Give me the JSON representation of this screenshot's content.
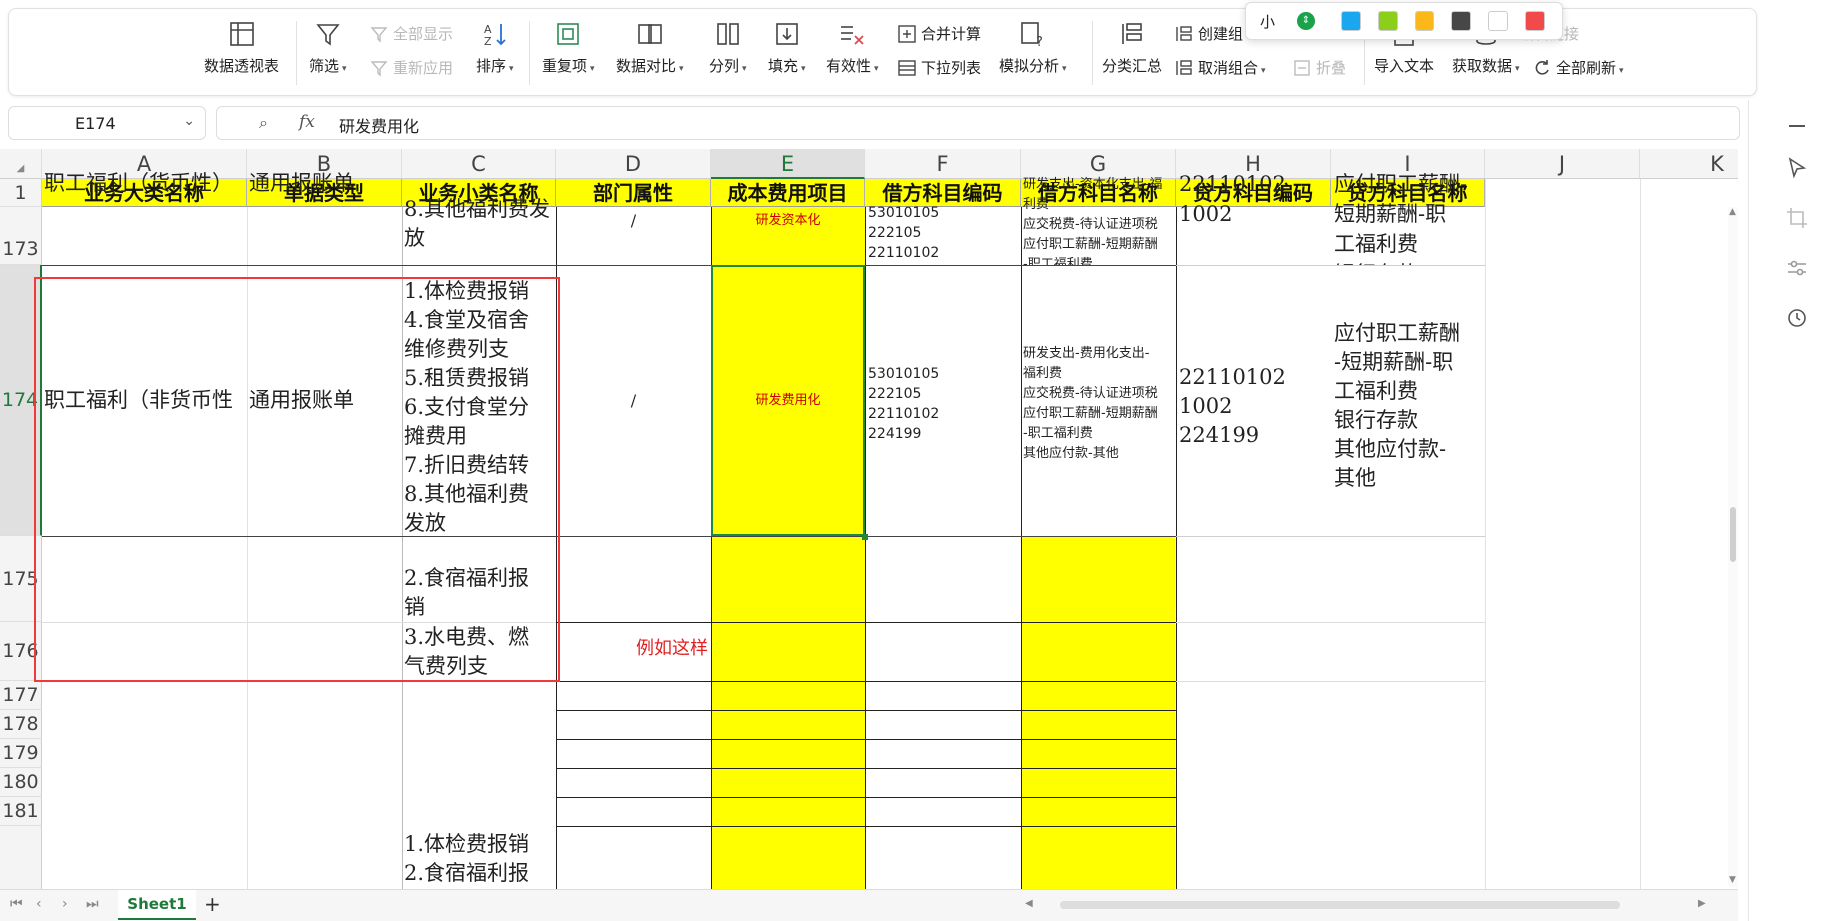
{
  "ribbon": {
    "pivot": "数据透视表",
    "filter": "筛选",
    "show_all": "全部显示",
    "reapply": "重新应用",
    "sort": "排序",
    "duplicates": "重复项",
    "compare": "数据对比",
    "split": "分列",
    "fill": "填充",
    "validity": "有效性",
    "consolidate": "合并计算",
    "dropdown_list": "下拉列表",
    "what_if": "模拟分析",
    "subtotal": "分类汇总",
    "group": "创建组",
    "ungroup": "取消组合",
    "collapse": "折叠",
    "import_text": "导入文本",
    "get_data": "获取数据",
    "refresh_all": "全部刷新",
    "edit_links": "编辑链接"
  },
  "color_popup": {
    "size": "小",
    "colors": [
      "#1aa7f0",
      "#8ccf1a",
      "#fbb818",
      "#474747",
      "#ffffff",
      "#f04a4a"
    ]
  },
  "formula_bar": {
    "name_box": "E174",
    "fx": "fx",
    "content": "研发费用化"
  },
  "columns": [
    "A",
    "B",
    "C",
    "D",
    "E",
    "F",
    "G",
    "H",
    "I",
    "J",
    "K"
  ],
  "rows": {
    "r1": "1",
    "r173": "173",
    "r174": "174",
    "r175": "175",
    "r176": "176",
    "r177": "177",
    "r178": "178",
    "r179": "179",
    "r180": "180",
    "r181": "181"
  },
  "headers": [
    "业务大类名称",
    "单据类型",
    "业务小类名称",
    "部门属性",
    "成本费用项目",
    "借方科目编码",
    "借方科目名称",
    "贷方科目编码",
    "贷方科目名称"
  ],
  "cells": {
    "a173": "职工福利（货币性）",
    "b173": "通用报账单",
    "c173": "8.其他福利费发\n放",
    "d173": "/",
    "e173": "研发资本化",
    "f173": "53010105\n222105\n22110102",
    "g173": "研发支出-资本化支出-福利费\n应交税费-待认证进项税\n应付职工薪酬-短期薪酬\n-职工福利费",
    "h173": "22110102\n1002",
    "i173": "应付职工薪酬-短期薪酬-职\n工福利费\n银行存款",
    "a174": "职工福利（非货币性",
    "b174": "通用报账单",
    "c174": "1.体检费报销\n4.食堂及宿舍\n维修费列支\n5.租赁费报销\n6.支付食堂分\n摊费用\n7.折旧费结转\n8.其他福利费\n发放",
    "d174": "/",
    "e174": "研发费用化",
    "f174": "53010105\n222105\n22110102\n224199",
    "g174": "研发支出-费用化支出-\n福利费\n应交税费-待认证进项税\n应付职工薪酬-短期薪酬\n-职工福利费\n其他应付款-其他",
    "h174": "22110102\n1002\n224199",
    "i174": "应付职工薪酬\n-短期薪酬-职\n工福利费\n银行存款\n其他应付款-\n其他",
    "c175": "2.食宿福利报\n销",
    "c176": "3.水电费、燃\n气费列支",
    "annotation": "例如这样",
    "c182": "1.体检费报销\n2.食宿福利报\n销"
  },
  "sheet_tab": "Sheet1",
  "add_sheet": "+"
}
